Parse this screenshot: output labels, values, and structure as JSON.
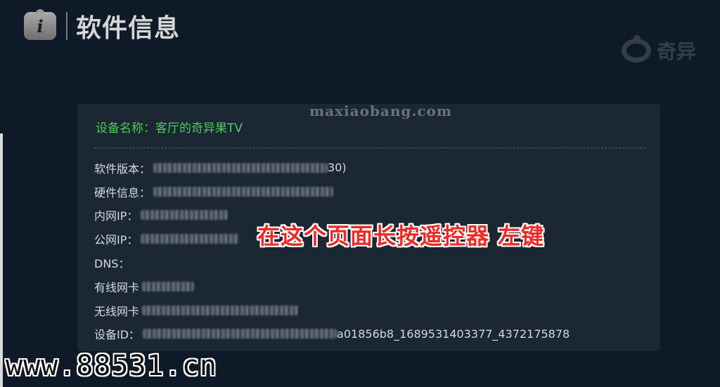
{
  "header": {
    "icon": "info-icon",
    "icon_glyph": "i",
    "title": "软件信息"
  },
  "brand": {
    "icon": "qiyiguo-logo-icon",
    "text": "奇异"
  },
  "watermark_top": "maxiaobang.com",
  "device_name": "设备名称：客厅的奇异果TV",
  "info_rows": [
    {
      "label": "软件版本：",
      "tail": "30)"
    },
    {
      "label": "硬件信息：",
      "tail": ""
    },
    {
      "label": "内网IP：",
      "tail": ""
    },
    {
      "label": "公网IP：",
      "tail": ""
    },
    {
      "label": "DNS：",
      "tail": ""
    },
    {
      "label": "有线网卡",
      "tail": ""
    },
    {
      "label": "无线网卡",
      "tail": ""
    },
    {
      "label": "设备ID：",
      "tail": "a01856b8_1689531403377_4372175878"
    }
  ],
  "overlay_instruction": "在这个页面长按遥控器 左键",
  "watermark_bottom": "www.88531.cn",
  "colors": {
    "background": "#0e1a27",
    "panel": "#1b2733",
    "device_name_green": "#4fcb5d",
    "overlay_red": "#ec2b25"
  }
}
